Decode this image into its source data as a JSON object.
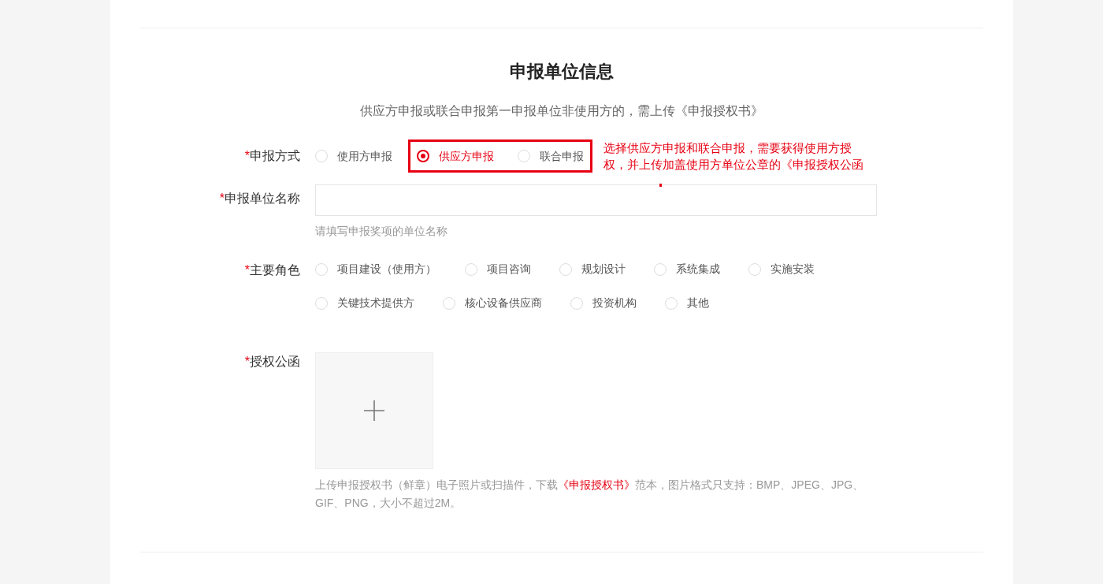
{
  "section": {
    "title": "申报单位信息",
    "subtitle": "供应方申报或联合申报第一申报单位非使用方的，需上传《申报授权书》"
  },
  "mode": {
    "label": "申报方式",
    "required_mark": "*",
    "option_groups": [
      {
        "framed": false,
        "options": [
          {
            "label": "使用方申报",
            "selected": false
          }
        ]
      },
      {
        "framed": true,
        "options": [
          {
            "label": "供应方申报",
            "selected": true
          },
          {
            "label": "联合申报",
            "selected": false
          }
        ]
      }
    ],
    "annotation": [
      "选择供应方申报和联合申报，需要获得使用方授",
      "权，并上传加盖使用方单位公章的《申报授权公函"
    ]
  },
  "unit_name": {
    "label": "申报单位名称",
    "required_mark": "*",
    "hint": "请填写申报奖项的单位名称"
  },
  "role": {
    "label": "主要角色",
    "required_mark": "*",
    "options": [
      {
        "label": "项目建设（使用方）",
        "selected": false
      },
      {
        "label": "项目咨询",
        "selected": false
      },
      {
        "label": "规划设计",
        "selected": false
      },
      {
        "label": "系统集成",
        "selected": false
      },
      {
        "label": "实施安装",
        "selected": false
      },
      {
        "label": "关键技术提供方",
        "selected": false
      },
      {
        "label": "核心设备供应商",
        "selected": false
      },
      {
        "label": "投资机构",
        "selected": false
      },
      {
        "label": "其他",
        "selected": false
      }
    ]
  },
  "letter": {
    "label": "授权公函",
    "required_mark": "*",
    "hint_before": "上传申报授权书（鲜章）电子照片或扫描件，下载",
    "hint_link": "《申报授权书》",
    "hint_after": "范本，图片格式只支持：BMP、JPEG、JPG、GIF、PNG，大小不超过2M。"
  }
}
